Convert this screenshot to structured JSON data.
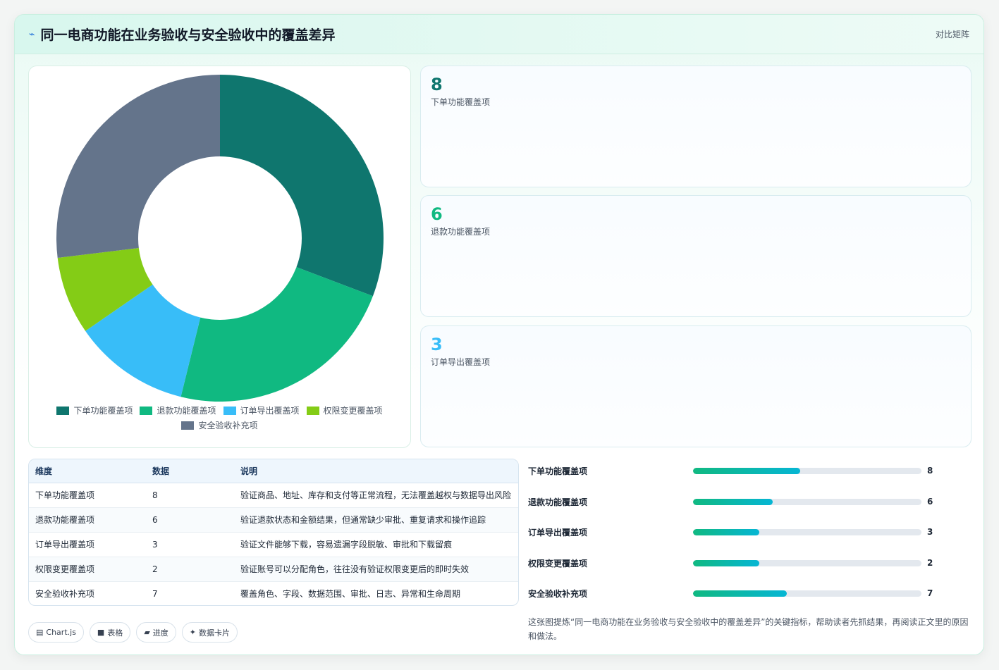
{
  "header": {
    "title": "同一电商功能在业务验收与安全验收中的覆盖差异",
    "right_label": "对比矩阵",
    "icon": "spark-icon"
  },
  "colors": {
    "series": [
      "#0f766e",
      "#10b981",
      "#38bdf8",
      "#84cc16",
      "#64748b"
    ]
  },
  "chart_data": {
    "type": "pie",
    "variant": "donut",
    "categories": [
      "下单功能覆盖项",
      "退款功能覆盖项",
      "订单导出覆盖项",
      "权限变更覆盖项",
      "安全验收补充项"
    ],
    "values": [
      8,
      6,
      3,
      2,
      7
    ],
    "legend_position": "bottom",
    "title": ""
  },
  "stats": [
    {
      "value": "8",
      "label": "下单功能覆盖项",
      "color": "#0f766e"
    },
    {
      "value": "6",
      "label": "退款功能覆盖项",
      "color": "#10b981"
    },
    {
      "value": "3",
      "label": "订单导出覆盖项",
      "color": "#38bdf8"
    }
  ],
  "table": {
    "headers": [
      "维度",
      "数据",
      "说明"
    ],
    "rows": [
      [
        "下单功能覆盖项",
        "8",
        "验证商品、地址、库存和支付等正常流程，无法覆盖越权与数据导出风险"
      ],
      [
        "退款功能覆盖项",
        "6",
        "验证退款状态和金额结果，但通常缺少审批、重复请求和操作追踪"
      ],
      [
        "订单导出覆盖项",
        "3",
        "验证文件能够下载，容易遗漏字段脱敏、审批和下载留痕"
      ],
      [
        "权限变更覆盖项",
        "2",
        "验证账号可以分配角色，往往没有验证权限变更后的即时失效"
      ],
      [
        "安全验收补充项",
        "7",
        "覆盖角色、字段、数据范围、审批、日志、异常和生命周期"
      ]
    ]
  },
  "bars": {
    "max": 8,
    "items": [
      {
        "label": "下单功能覆盖项",
        "value": 8,
        "fill": 0.47
      },
      {
        "label": "退款功能覆盖项",
        "value": 6,
        "fill": 0.35
      },
      {
        "label": "订单导出覆盖项",
        "value": 3,
        "fill": 0.29
      },
      {
        "label": "权限变更覆盖项",
        "value": 2,
        "fill": 0.29
      },
      {
        "label": "安全验收补充项",
        "value": 7,
        "fill": 0.41
      }
    ]
  },
  "chips": [
    {
      "icon": "chart-icon",
      "glyph": "▤",
      "label": "Chart.js"
    },
    {
      "icon": "table-icon",
      "glyph": "■",
      "label": "表格"
    },
    {
      "icon": "progress-icon",
      "glyph": "▰",
      "label": "进度"
    },
    {
      "icon": "card-icon",
      "glyph": "✦",
      "label": "数据卡片"
    }
  ],
  "note": "这张图提炼“同一电商功能在业务验收与安全验收中的覆盖差异”的关键指标，帮助读者先抓结果，再阅读正文里的原因和做法。"
}
